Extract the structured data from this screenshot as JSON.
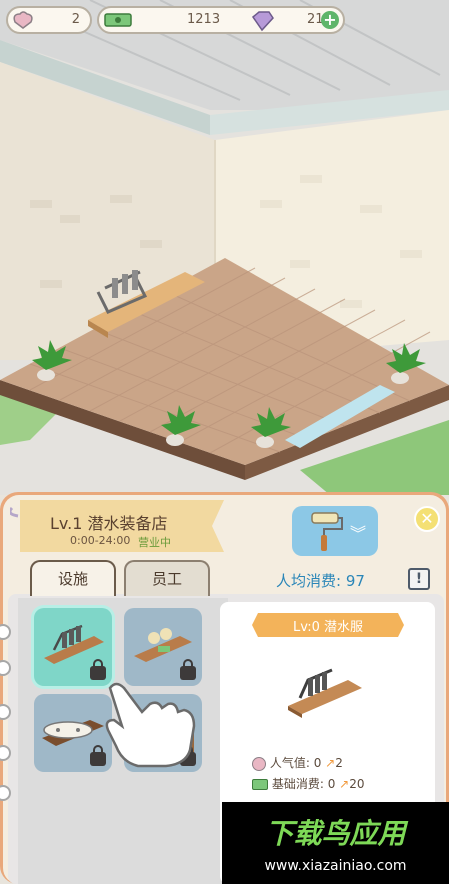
{
  "resources": {
    "hearts": "2",
    "cash": "1213",
    "gems": "21",
    "gems_add_icon": "plus-icon"
  },
  "shop": {
    "title": "Lv.1 潜水装备店",
    "hours": "0:00-24:00",
    "status": "营业中"
  },
  "tabs": {
    "facilities": "设施",
    "staff": "员工"
  },
  "avg_spend": {
    "label": "人均消费: ",
    "value": "97"
  },
  "info_button": "!",
  "detail": {
    "title": "Lv:0 潜水服",
    "popularity_label": "人气值: ",
    "popularity_base": "0",
    "popularity_bonus": "2",
    "base_spend_label": "基础消费: ",
    "base_spend_base": "0",
    "base_spend_bonus": "20"
  },
  "watermark": {
    "brand": "下载鸟应用",
    "url": "www.xiazainiao.com"
  },
  "colors": {
    "panel_bg": "#f3ede2",
    "ribbon": "#f2d9a0",
    "floor": "#c9a486",
    "accent_text": "#2a86b8"
  }
}
